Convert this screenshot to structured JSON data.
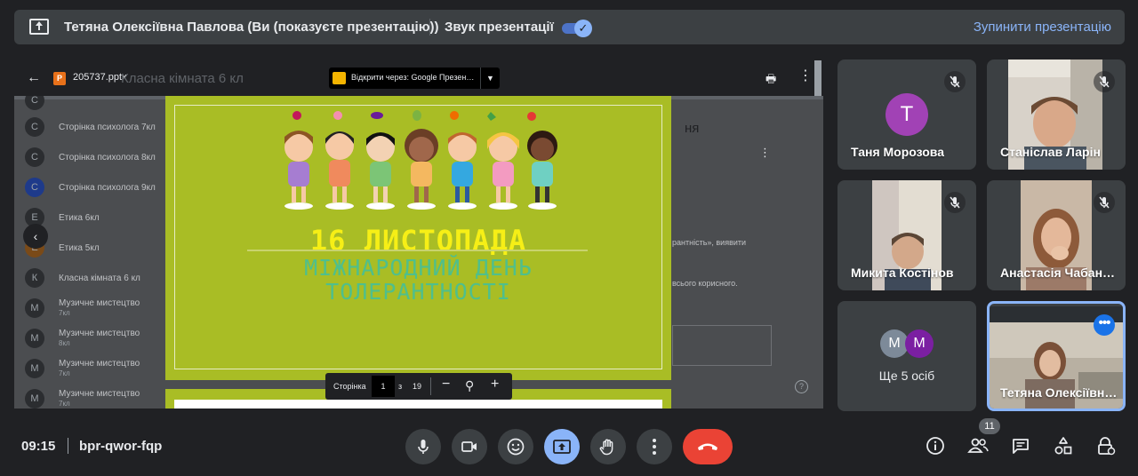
{
  "banner": {
    "title": "Тетяна Олексіївна Павлова (Ви (показуєте презентацію))",
    "sound_label": "Звук презентації",
    "sound_on": true,
    "stop_label": "Зупинити презентацію"
  },
  "viewer": {
    "file_name": "205737.pptx",
    "file_icon": "P",
    "background_title": "Класна кімната 6 кл",
    "open_with": "Відкрити через: Google Презен…",
    "background_list": [
      {
        "initial": "С",
        "label": "Сторінка психолога 7кл",
        "sub": ""
      },
      {
        "initial": "С",
        "label": "Сторінка психолога 8кл",
        "sub": ""
      },
      {
        "initial": "С",
        "label": "Сторінка психолога 9кл",
        "sub": ""
      },
      {
        "initial": "Е",
        "label": "Етика 6кл",
        "sub": ""
      },
      {
        "initial": "Е",
        "label": "Етика 5кл",
        "sub": ""
      },
      {
        "initial": "К",
        "label": "Класна кімната 6 кл",
        "sub": ""
      },
      {
        "initial": "М",
        "label": "Музичне мистецтво",
        "sub": "7кл"
      },
      {
        "initial": "М",
        "label": "Музичне мистецтво",
        "sub": "8кл"
      },
      {
        "initial": "М",
        "label": "Музичне мистецтво",
        "sub": "7кл"
      },
      {
        "initial": "М",
        "label": "Музичне мистецтво",
        "sub": "7кл"
      }
    ],
    "background_fragments": [
      "ня",
      "рантність», виявити",
      "всього корисного."
    ],
    "pager": {
      "label": "Сторінка",
      "current": "1",
      "of": "з",
      "total": "19"
    }
  },
  "slide": {
    "headline": "16 ЛИСТОПАДА",
    "subline1": "МІЖНАРОДНИЙ ДЕНЬ",
    "subline2": "ТОЛЕРАНТНОСТІ",
    "bg_color": "#a9bd25",
    "headline_color": "#f6ef16",
    "subline_color": "#4fbf8c"
  },
  "participants": [
    {
      "name": "Таня Морозова",
      "avatar_letter": "Т",
      "avatar_color": "#a142b5",
      "muted": true
    },
    {
      "name": "Станіслав Ларін",
      "muted": true
    },
    {
      "name": "Микита Костінов",
      "muted": true
    },
    {
      "name": "Анастасія Чабаненко",
      "muted": true
    },
    {
      "name": "Ще 5 осіб",
      "letters": [
        "М",
        "М"
      ],
      "colors": [
        "#7d8a99",
        "#7b1fa2"
      ]
    },
    {
      "name": "Тетяна Олексіївна Павлова",
      "selected": true
    }
  ],
  "bottom": {
    "time": "09:15",
    "meeting_code": "bpr-qwor-fqp",
    "participant_count": "11",
    "controls": [
      "mic-icon",
      "camera-icon",
      "emoji-icon",
      "present-icon",
      "raise-hand-icon",
      "more-icon",
      "hang-up-icon"
    ],
    "right": [
      "info-icon",
      "people-icon",
      "chat-icon",
      "activities-icon",
      "host-controls-icon"
    ]
  }
}
